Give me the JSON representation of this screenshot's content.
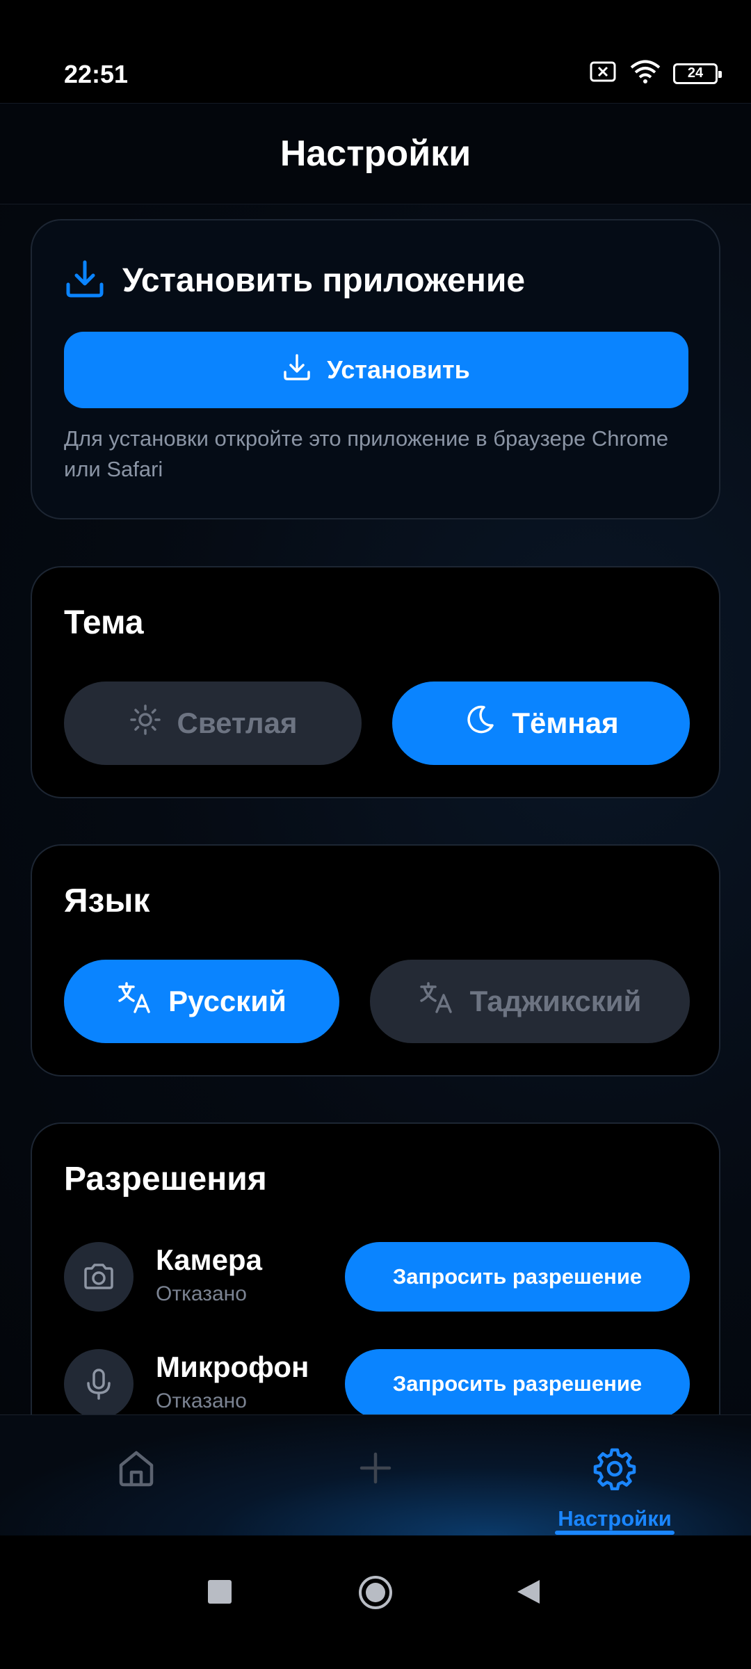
{
  "status_bar": {
    "time": "22:51",
    "battery": "24"
  },
  "header": {
    "title": "Настройки"
  },
  "install": {
    "title": "Установить приложение",
    "button_label": "Установить",
    "note": "Для установки откройте это приложение в браузере Chrome или Safari"
  },
  "theme": {
    "title": "Тема",
    "light_label": "Светлая",
    "dark_label": "Тёмная",
    "selected": "Тёмная"
  },
  "language": {
    "title": "Язык",
    "russian_label": "Русский",
    "tajik_label": "Таджикский",
    "selected": "Русский"
  },
  "permissions": {
    "title": "Разрешения",
    "items": [
      {
        "name": "Камера",
        "status": "Отказано",
        "button_label": "Запросить разрешение",
        "icon": "camera-icon"
      },
      {
        "name": "Микрофон",
        "status": "Отказано",
        "button_label": "Запросить разрешение",
        "icon": "microphone-icon"
      }
    ]
  },
  "bottom_nav": {
    "items": [
      {
        "icon": "home-icon",
        "label": ""
      },
      {
        "icon": "plus-icon",
        "label": ""
      },
      {
        "icon": "gear-icon",
        "label": "Настройки",
        "active": true
      }
    ]
  },
  "colors": {
    "accent": "#0a84ff",
    "card_border": "#1d2633",
    "inactive_pill": "#242a35"
  }
}
